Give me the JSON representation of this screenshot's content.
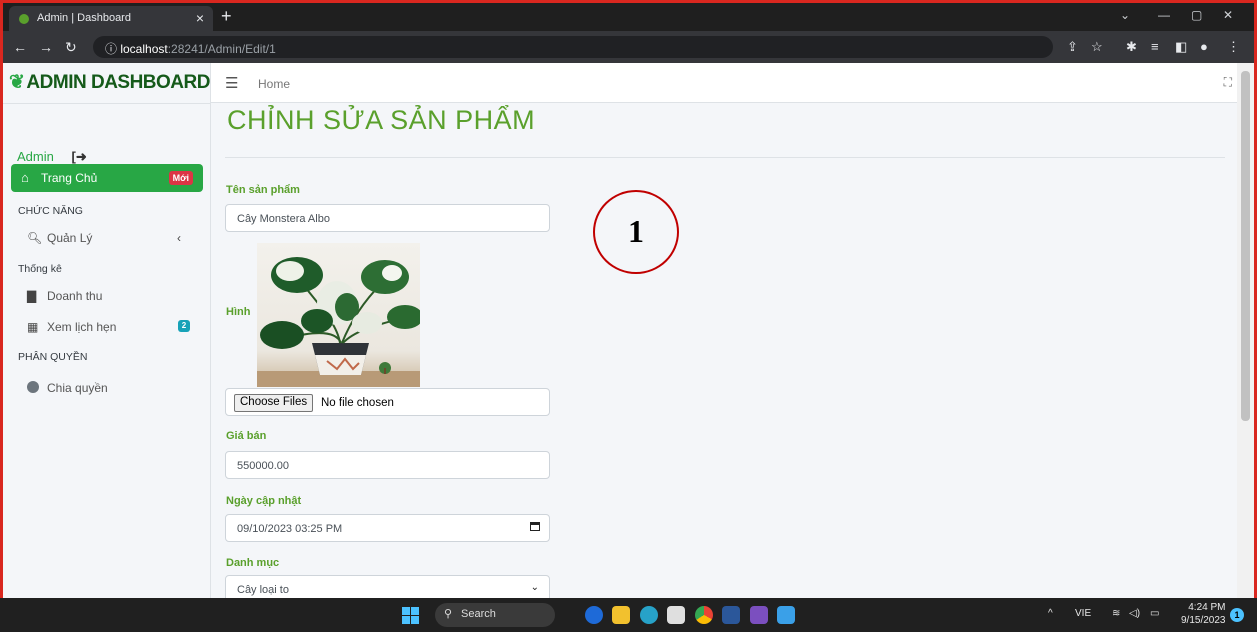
{
  "browser": {
    "tab_title": "Admin | Dashboard",
    "tab_close": "×",
    "new_tab": "+",
    "url_host": "localhost",
    "url_path": ":28241/Admin/Edit/1"
  },
  "sidebar": {
    "brand": "ADMIN DASHBOARD",
    "user_name": "Admin",
    "active_item": {
      "label": "Trang Chủ",
      "badge": "Mới"
    },
    "sections": [
      {
        "title": "CHỨC NĂNG"
      },
      {
        "title": "Thống kê"
      },
      {
        "title": "PHÂN QUYỀN"
      }
    ],
    "items": [
      {
        "label": "Quản Lý",
        "icon": "search-icon"
      },
      {
        "label": "Doanh thu",
        "icon": "file-icon"
      },
      {
        "label": "Xem lịch hẹn",
        "icon": "calendar-icon",
        "badge": "2"
      },
      {
        "label": "Chia quyền",
        "icon": "circle-icon"
      }
    ]
  },
  "topnav": {
    "home": "Home"
  },
  "page": {
    "title": "CHỈNH SỬA SẢN PHẨM",
    "fields": {
      "name": {
        "label": "Tên sản phẩm",
        "value": "Cây Monstera Albo"
      },
      "image": {
        "label": "Hình",
        "button": "Choose Files",
        "status": "No file chosen"
      },
      "price": {
        "label": "Giá bán",
        "value": "550000.00"
      },
      "updated": {
        "label": "Ngày cập nhật",
        "value": "09/10/2023 03:25 PM"
      },
      "category": {
        "label": "Danh mục",
        "value": "Cây loại to"
      }
    }
  },
  "annotation": {
    "marker": "1"
  },
  "taskbar": {
    "search": "Search",
    "lang": "VIE",
    "time": "4:24 PM",
    "date": "9/15/2023",
    "notifications": "1"
  },
  "colors": {
    "accent": "#5aa02c",
    "active_menu": "#28a745",
    "frame": "#d9271f"
  }
}
